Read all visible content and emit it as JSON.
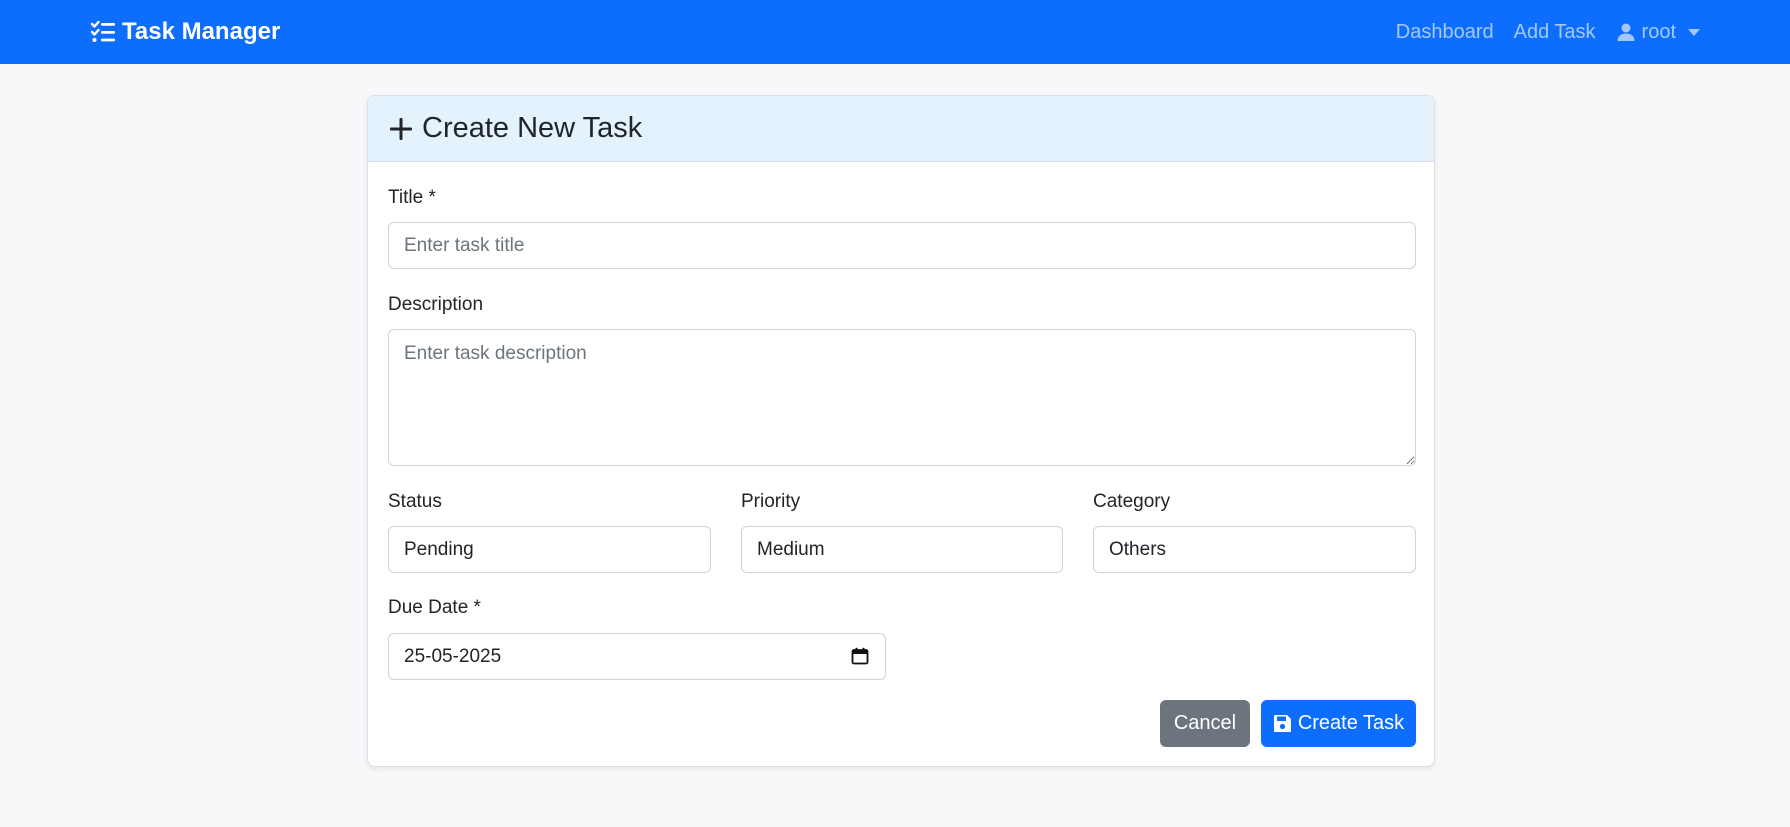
{
  "navbar": {
    "brand": "Task Manager",
    "brand_icon": "tasks-icon",
    "links": [
      {
        "label": "Dashboard"
      },
      {
        "label": "Add Task"
      }
    ],
    "user": {
      "name": "root",
      "icon": "user-icon"
    }
  },
  "form": {
    "header_title": "Create New Task",
    "header_icon": "plus-icon",
    "title_label": "Title *",
    "title_placeholder": "Enter task title",
    "title_value": "",
    "description_label": "Description",
    "description_placeholder": "Enter task description",
    "description_value": "",
    "status_label": "Status",
    "status_value": "Pending",
    "priority_label": "Priority",
    "priority_value": "Medium",
    "category_label": "Category",
    "category_value": "Others",
    "due_date_label": "Due Date *",
    "due_date_value": "25-05-2025",
    "cancel_label": "Cancel",
    "create_label": "Create Task"
  },
  "colors": {
    "primary": "#0d6efd",
    "secondary": "#6c757d",
    "header_bg": "#e3f2fd"
  }
}
